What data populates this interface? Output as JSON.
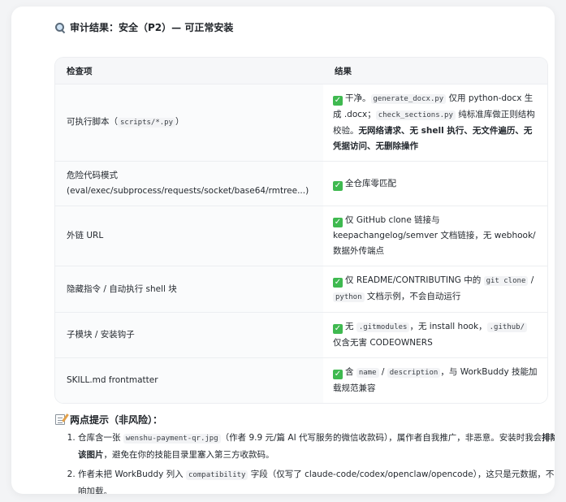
{
  "heading": "审计结果：安全（P2）— 可正常安装",
  "table": {
    "headers": [
      "检查项",
      "结果"
    ],
    "rows": [
      {
        "item": {
          "pre": "可执行脚本（",
          "code": "scripts/*.py",
          "post": "）"
        },
        "result": {
          "t1": "干净。",
          "c1": "generate_docx.py",
          "t2": " 仅用 python-docx 生成 .docx；",
          "c2": "check_sections.py",
          "t3": " 纯标准库做正则结构校验。",
          "b1": "无网络请求、无 shell 执行、无文件遍历、无凭据访问、无删除操作"
        }
      },
      {
        "item": {
          "line1": "危险代码模式",
          "line2": "(eval/exec/subprocess/requests/socket/base64/rmtree...)"
        },
        "result": {
          "t1": "全仓库零匹配"
        }
      },
      {
        "item": {
          "text": "外链 URL"
        },
        "result": {
          "t1": "仅 GitHub clone 链接与 keepachangelog/semver 文档链接，无 webhook/数据外传端点"
        }
      },
      {
        "item": {
          "text": "隐藏指令 / 自动执行 shell 块"
        },
        "result": {
          "t1": "仅 README/CONTRIBUTING 中的 ",
          "c1": "git clone",
          "t2": " / ",
          "c2": "python",
          "t3": " 文档示例，不会自动运行"
        }
      },
      {
        "item": {
          "text": "子模块 / 安装钩子"
        },
        "result": {
          "t1": "无 ",
          "c1": ".gitmodules",
          "t2": "，无 install hook，",
          "c2": ".github/",
          "t3": " 仅含无害 CODEOWNERS"
        }
      },
      {
        "item": {
          "text": "SKILL.md frontmatter"
        },
        "result": {
          "t1": "含 ",
          "c1": "name",
          "t2": " / ",
          "c2": "description",
          "t3": "，与 WorkBuddy 技能加载规范兼容"
        }
      }
    ]
  },
  "notes": {
    "title": "两点提示（非风险）：",
    "items": [
      {
        "t1": "仓库含一张 ",
        "c1": "wenshu-payment-qr.jpg",
        "t2": "（作者 9.9 元/篇 AI 代写服务的微信收款码），属作者自我推广，非恶意。安装时我会",
        "b1": "排除该图片",
        "t3": "，避免在你的技能目录里塞入第三方收款码。"
      },
      {
        "t1": "作者未把 WorkBuddy 列入 ",
        "c1": "compatibility",
        "t2": " 字段（仅写了 claude-code/codex/openclaw/opencode），这只是元数据，不影响加载。"
      }
    ]
  }
}
